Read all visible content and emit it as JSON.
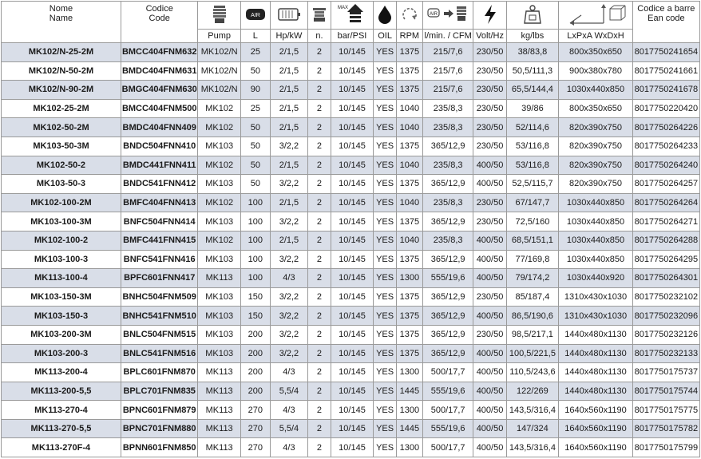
{
  "header": {
    "name_line1": "Nome",
    "name_line2": "Name",
    "code_line1": "Codice",
    "code_line2": "Code",
    "ean_line1": "Codice a barre",
    "ean_line2": "Ean code",
    "air_badge": "AIR",
    "max_badge": "MAX",
    "icons": [
      "pump-head-icon",
      "air-badge-icon",
      "motor-icon",
      "cylinder-icon",
      "pressure-arrow-icon",
      "oil-drop-icon",
      "rotation-icon",
      "air-flow-icon",
      "lightning-icon",
      "weight-icon",
      "dimensions-icon"
    ],
    "sub_labels": [
      "Pump",
      "L",
      "Hp/kW",
      "n.",
      "bar/PSI",
      "OIL",
      "RPM",
      "l/min. / CFM",
      "Volt/Hz",
      "kg/lbs",
      "LxPxA  WxDxH"
    ]
  },
  "rows": [
    {
      "shade": true,
      "c": [
        "MK102/N-25-2M",
        "BMCC404FNM632",
        "MK102/N",
        "25",
        "2/1,5",
        "2",
        "10/145",
        "YES",
        "1375",
        "215/7,6",
        "230/50",
        "38/83,8",
        "800x350x650",
        "8017750241654"
      ]
    },
    {
      "shade": false,
      "c": [
        "MK102/N-50-2M",
        "BMDC404FNM631",
        "MK102/N",
        "50",
        "2/1,5",
        "2",
        "10/145",
        "YES",
        "1375",
        "215/7,6",
        "230/50",
        "50,5/111,3",
        "900x380x780",
        "8017750241661"
      ]
    },
    {
      "shade": true,
      "c": [
        "MK102/N-90-2M",
        "BMGC404FNM630",
        "MK102/N",
        "90",
        "2/1,5",
        "2",
        "10/145",
        "YES",
        "1375",
        "215/7,6",
        "230/50",
        "65,5/144,4",
        "1030x440x850",
        "8017750241678"
      ]
    },
    {
      "shade": false,
      "c": [
        "MK102-25-2M",
        "BMCC404FNM500",
        "MK102",
        "25",
        "2/1,5",
        "2",
        "10/145",
        "YES",
        "1040",
        "235/8,3",
        "230/50",
        "39/86",
        "800x350x650",
        "8017750220420"
      ]
    },
    {
      "shade": true,
      "c": [
        "MK102-50-2M",
        "BMDC404FNN409",
        "MK102",
        "50",
        "2/1,5",
        "2",
        "10/145",
        "YES",
        "1040",
        "235/8,3",
        "230/50",
        "52/114,6",
        "820x390x750",
        "8017750264226"
      ]
    },
    {
      "shade": false,
      "c": [
        "MK103-50-3M",
        "BNDC504FNN410",
        "MK103",
        "50",
        "3/2,2",
        "2",
        "10/145",
        "YES",
        "1375",
        "365/12,9",
        "230/50",
        "53/116,8",
        "820x390x750",
        "8017750264233"
      ]
    },
    {
      "shade": true,
      "c": [
        "MK102-50-2",
        "BMDC441FNN411",
        "MK102",
        "50",
        "2/1,5",
        "2",
        "10/145",
        "YES",
        "1040",
        "235/8,3",
        "400/50",
        "53/116,8",
        "820x390x750",
        "8017750264240"
      ]
    },
    {
      "shade": false,
      "c": [
        "MK103-50-3",
        "BNDC541FNN412",
        "MK103",
        "50",
        "3/2,2",
        "2",
        "10/145",
        "YES",
        "1375",
        "365/12,9",
        "400/50",
        "52,5/115,7",
        "820x390x750",
        "8017750264257"
      ]
    },
    {
      "shade": true,
      "c": [
        "MK102-100-2M",
        "BMFC404FNN413",
        "MK102",
        "100",
        "2/1,5",
        "2",
        "10/145",
        "YES",
        "1040",
        "235/8,3",
        "230/50",
        "67/147,7",
        "1030x440x850",
        "8017750264264"
      ]
    },
    {
      "shade": false,
      "c": [
        "MK103-100-3M",
        "BNFC504FNN414",
        "MK103",
        "100",
        "3/2,2",
        "2",
        "10/145",
        "YES",
        "1375",
        "365/12,9",
        "230/50",
        "72,5/160",
        "1030x440x850",
        "8017750264271"
      ]
    },
    {
      "shade": true,
      "c": [
        "MK102-100-2",
        "BMFC441FNN415",
        "MK102",
        "100",
        "2/1,5",
        "2",
        "10/145",
        "YES",
        "1040",
        "235/8,3",
        "400/50",
        "68,5/151,1",
        "1030x440x850",
        "8017750264288"
      ]
    },
    {
      "shade": false,
      "c": [
        "MK103-100-3",
        "BNFC541FNN416",
        "MK103",
        "100",
        "3/2,2",
        "2",
        "10/145",
        "YES",
        "1375",
        "365/12,9",
        "400/50",
        "77/169,8",
        "1030x440x850",
        "8017750264295"
      ]
    },
    {
      "shade": true,
      "c": [
        "MK113-100-4",
        "BPFC601FNN417",
        "MK113",
        "100",
        "4/3",
        "2",
        "10/145",
        "YES",
        "1300",
        "555/19,6",
        "400/50",
        "79/174,2",
        "1030x440x920",
        "8017750264301"
      ]
    },
    {
      "shade": false,
      "c": [
        "MK103-150-3M",
        "BNHC504FNM509",
        "MK103",
        "150",
        "3/2,2",
        "2",
        "10/145",
        "YES",
        "1375",
        "365/12,9",
        "230/50",
        "85/187,4",
        "1310x430x1030",
        "8017750232102"
      ]
    },
    {
      "shade": true,
      "c": [
        "MK103-150-3",
        "BNHC541FNM510",
        "MK103",
        "150",
        "3/2,2",
        "2",
        "10/145",
        "YES",
        "1375",
        "365/12,9",
        "400/50",
        "86,5/190,6",
        "1310x430x1030",
        "8017750232096"
      ]
    },
    {
      "shade": false,
      "c": [
        "MK103-200-3M",
        "BNLC504FNM515",
        "MK103",
        "200",
        "3/2,2",
        "2",
        "10/145",
        "YES",
        "1375",
        "365/12,9",
        "230/50",
        "98,5/217,1",
        "1440x480x1130",
        "8017750232126"
      ]
    },
    {
      "shade": true,
      "c": [
        "MK103-200-3",
        "BNLC541FNM516",
        "MK103",
        "200",
        "3/2,2",
        "2",
        "10/145",
        "YES",
        "1375",
        "365/12,9",
        "400/50",
        "100,5/221,5",
        "1440x480x1130",
        "8017750232133"
      ]
    },
    {
      "shade": false,
      "c": [
        "MK113-200-4",
        "BPLC601FNM870",
        "MK113",
        "200",
        "4/3",
        "2",
        "10/145",
        "YES",
        "1300",
        "500/17,7",
        "400/50",
        "110,5/243,6",
        "1440x480x1130",
        "8017750175737"
      ]
    },
    {
      "shade": true,
      "c": [
        "MK113-200-5,5",
        "BPLC701FNM835",
        "MK113",
        "200",
        "5,5/4",
        "2",
        "10/145",
        "YES",
        "1445",
        "555/19,6",
        "400/50",
        "122/269",
        "1440x480x1130",
        "8017750175744"
      ]
    },
    {
      "shade": false,
      "c": [
        "MK113-270-4",
        "BPNC601FNM879",
        "MK113",
        "270",
        "4/3",
        "2",
        "10/145",
        "YES",
        "1300",
        "500/17,7",
        "400/50",
        "143,5/316,4",
        "1640x560x1190",
        "8017750175775"
      ]
    },
    {
      "shade": true,
      "c": [
        "MK113-270-5,5",
        "BPNC701FNM880",
        "MK113",
        "270",
        "5,5/4",
        "2",
        "10/145",
        "YES",
        "1445",
        "555/19,6",
        "400/50",
        "147/324",
        "1640x560x1190",
        "8017750175782"
      ]
    },
    {
      "shade": false,
      "c": [
        "MK113-270F-4",
        "BPNN601FNM850",
        "MK113",
        "270",
        "4/3",
        "2",
        "10/145",
        "YES",
        "1300",
        "500/17,7",
        "400/50",
        "143,5/316,4",
        "1640x560x1190",
        "8017750175799"
      ]
    }
  ]
}
